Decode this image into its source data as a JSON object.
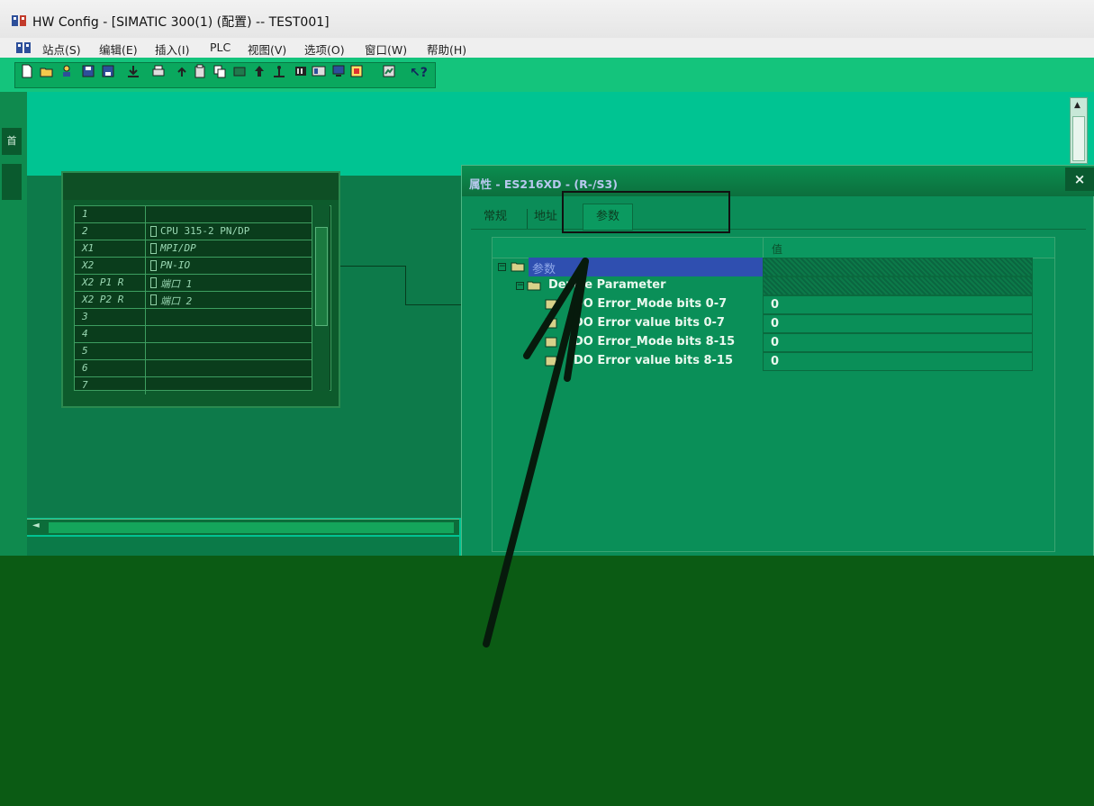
{
  "window": {
    "title": "HW Config - [SIMATIC 300(1) (配置) -- TEST001]"
  },
  "menu": {
    "items": [
      {
        "id": "station",
        "label": "站点(S)"
      },
      {
        "id": "edit",
        "label": "编辑(E)"
      },
      {
        "id": "insert",
        "label": "插入(I)"
      },
      {
        "id": "plc",
        "label": "PLC"
      },
      {
        "id": "view",
        "label": "视图(V)"
      },
      {
        "id": "options",
        "label": "选项(O)"
      },
      {
        "id": "window",
        "label": "窗口(W)"
      },
      {
        "id": "help",
        "label": "帮助(H)"
      }
    ]
  },
  "toolbar": {
    "help_label": "?"
  },
  "left_strip": {
    "tab1": "首"
  },
  "rack": {
    "rows": [
      {
        "slot": "1",
        "module": ""
      },
      {
        "slot": "2",
        "module": "CPU 315-2 PN/DP"
      },
      {
        "slot": "X1",
        "module": "MPI/DP"
      },
      {
        "slot": "X2",
        "module": "PN-IO"
      },
      {
        "slot": "X2 P1 R",
        "module": "端口 1"
      },
      {
        "slot": "X2 P2 R",
        "module": "端口 2"
      },
      {
        "slot": "3",
        "module": ""
      },
      {
        "slot": "4",
        "module": ""
      },
      {
        "slot": "5",
        "module": ""
      },
      {
        "slot": "6",
        "module": ""
      },
      {
        "slot": "7",
        "module": ""
      }
    ]
  },
  "dialog": {
    "title": "属性 - ES216XD - (R-/S3)",
    "close_label": "×",
    "tabs": {
      "general": "常规",
      "address": "地址",
      "parameters": "参数"
    },
    "table": {
      "value_header": "值",
      "rows": [
        {
          "name": "参数",
          "value": ""
        },
        {
          "name": "Device Parameter",
          "value": ""
        },
        {
          "name": "DO Error_Mode bits 0-7",
          "value": "0"
        },
        {
          "name": "DO Error value bits 0-7",
          "value": "0"
        },
        {
          "name": "DO Error_Mode bits 8-15",
          "value": "0"
        },
        {
          "name": "DO Error value bits 8-15",
          "value": "0"
        }
      ]
    }
  }
}
